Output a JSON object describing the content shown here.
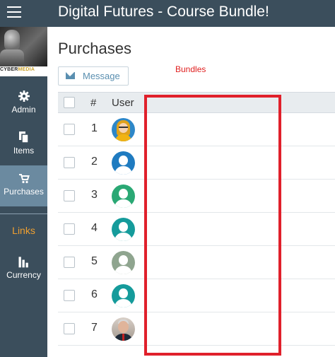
{
  "app": {
    "title": "Digital Futures - Course Bundle!"
  },
  "logo": {
    "text_a": "CYBER",
    "text_b": "MEDIA"
  },
  "sidebar": {
    "items": [
      {
        "label": "Admin",
        "icon": "gear-icon"
      },
      {
        "label": "Items",
        "icon": "copy-icon"
      },
      {
        "label": "Purchases",
        "icon": "cart-icon",
        "active": true
      },
      {
        "label": "Links",
        "icon": ""
      },
      {
        "label": "Currency",
        "icon": "bar-chart-icon"
      }
    ]
  },
  "page": {
    "title": "Purchases",
    "message_button": "Message",
    "annotation": "Bundles"
  },
  "table": {
    "headers": {
      "number": "#",
      "user": "User"
    },
    "rows": [
      {
        "num": "1",
        "avatar": "female-avatar"
      },
      {
        "num": "2",
        "avatar": "user-avatar",
        "color": "#1f7bc0"
      },
      {
        "num": "3",
        "avatar": "user-avatar",
        "color": "#2aa874"
      },
      {
        "num": "4",
        "avatar": "user-avatar",
        "color": "#159b9b"
      },
      {
        "num": "5",
        "avatar": "user-avatar",
        "color": "#8fa58f"
      },
      {
        "num": "6",
        "avatar": "user-avatar",
        "color": "#159b9b"
      },
      {
        "num": "7",
        "avatar": "photo-avatar"
      }
    ]
  },
  "colors": {
    "topbar": "#3b4e5c",
    "active_nav": "#6b8aa0",
    "links": "#f0a030",
    "highlight": "#e0202b"
  }
}
